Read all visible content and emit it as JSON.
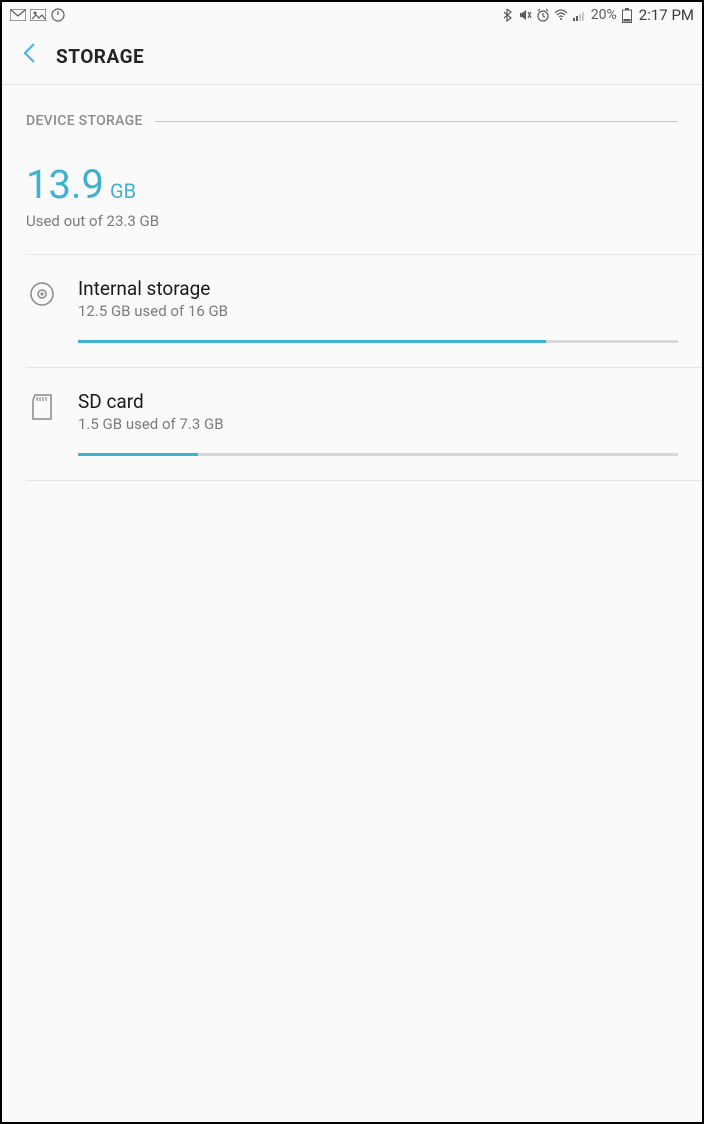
{
  "status": {
    "battery_text": "20%",
    "time": "2:17 PM"
  },
  "appbar": {
    "title": "STORAGE"
  },
  "section": {
    "header": "DEVICE STORAGE",
    "summary_value": "13.9",
    "summary_unit": "GB",
    "summary_sub": "Used out of 23.3 GB"
  },
  "items": [
    {
      "title": "Internal storage",
      "sub": "12.5 GB used of 16 GB",
      "progress_percent": 78
    },
    {
      "title": "SD card",
      "sub": "1.5 GB used of 7.3 GB",
      "progress_percent": 20
    }
  ]
}
